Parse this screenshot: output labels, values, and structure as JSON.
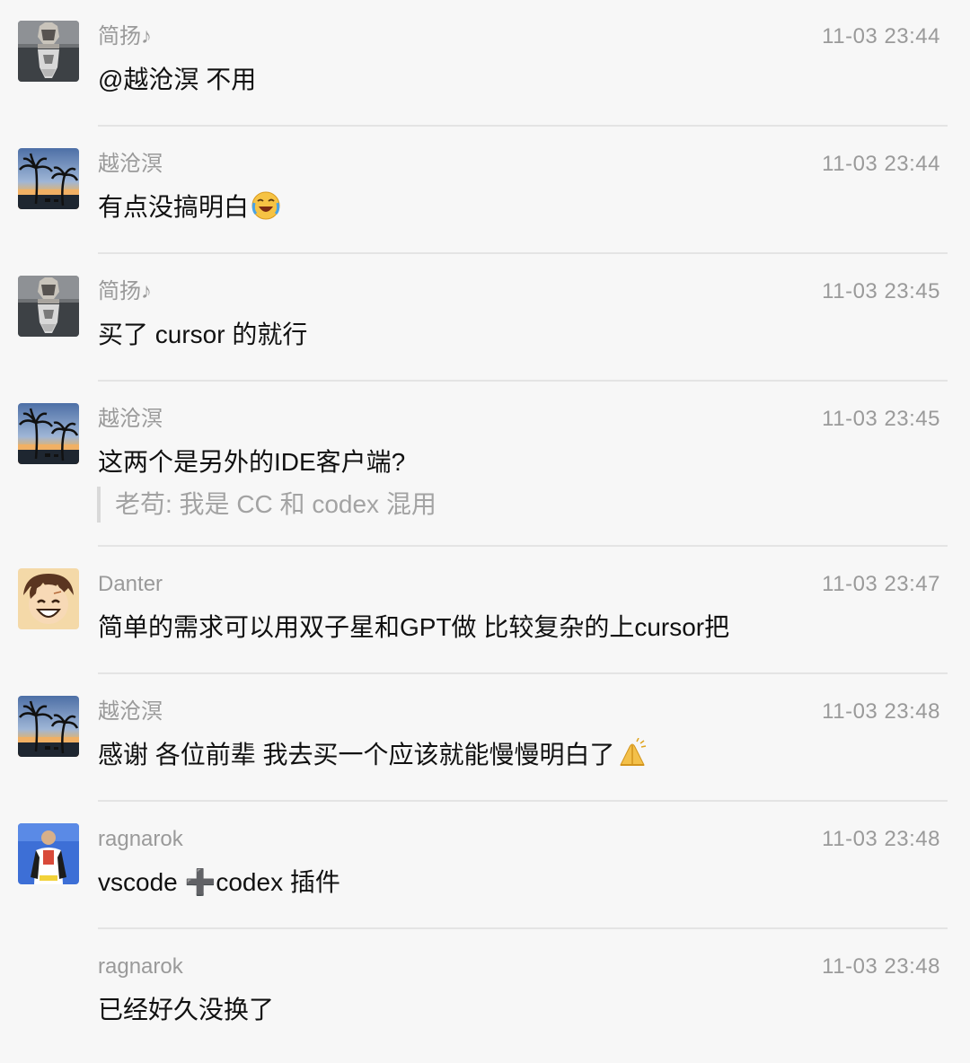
{
  "messages": [
    {
      "sender": "简扬♪",
      "time": "11-03 23:44",
      "text": "@越沧溟 不用",
      "avatar": "tiger-reflection-avatar"
    },
    {
      "sender": "越沧溟",
      "time": "11-03 23:44",
      "text": "有点没搞明白",
      "emoji": "laughing-crying-emoji",
      "avatar": "palm-sunset-avatar"
    },
    {
      "sender": "简扬♪",
      "time": "11-03 23:45",
      "text": "买了 cursor 的就行",
      "avatar": "tiger-reflection-avatar"
    },
    {
      "sender": "越沧溟",
      "time": "11-03 23:45",
      "text": "这两个是另外的IDE客户端?",
      "quote": "老苟: 我是 CC 和 codex 混用",
      "avatar": "palm-sunset-avatar"
    },
    {
      "sender": "Danter",
      "time": "11-03 23:47",
      "text": "简单的需求可以用双子星和GPT做 比较复杂的上cursor把",
      "avatar": "anime-boy-avatar"
    },
    {
      "sender": "越沧溟",
      "time": "11-03 23:48",
      "text": "感谢 各位前辈  我去买一个应该就能慢慢明白了",
      "emoji": "praying-hands-emoji",
      "avatar": "palm-sunset-avatar"
    },
    {
      "sender": "ragnarok",
      "time": "11-03 23:48",
      "text": "vscode ➕codex 插件",
      "avatar": "man-on-stage-avatar"
    },
    {
      "sender": "ragnarok",
      "time": "11-03 23:48",
      "text": "已经好久没换了"
    }
  ],
  "colors": {
    "background": "#f7f7f7",
    "meta_text": "#9a9a9a",
    "message_text": "#111111",
    "quote_text": "#a3a3a3",
    "divider": "#e4e4e4"
  }
}
